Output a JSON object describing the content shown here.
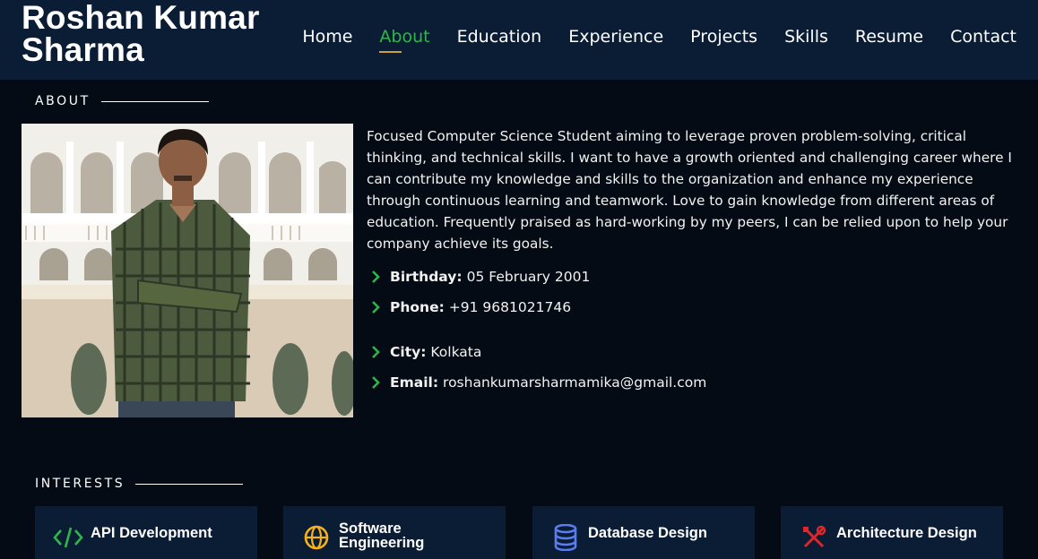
{
  "header": {
    "brand_line1": "Roshan Kumar",
    "brand_line2": "Sharma",
    "nav": [
      {
        "label": "Home"
      },
      {
        "label": "About",
        "active": true
      },
      {
        "label": "Education"
      },
      {
        "label": "Experience"
      },
      {
        "label": "Projects"
      },
      {
        "label": "Skills"
      },
      {
        "label": "Resume"
      },
      {
        "label": "Contact"
      }
    ]
  },
  "about": {
    "section_title": "ABOUT",
    "description": "Focused Computer Science Student aiming to leverage proven problem-solving, critical thinking, and technical skills. I want to have a growth oriented and challenging career where I can contribute my knowledge and skills to the organization and enhance my experience through continuous learning and teamwork. Love to gain knowledge from different areas of education. Frequently praised as hard-working by my peers, I can be relied upon to help your company achieve its goals.",
    "info": [
      {
        "label": "Birthday:",
        "value": "05 February 2001"
      },
      {
        "label": "Phone:",
        "value": "+91 9681021746"
      },
      {
        "label": "City:",
        "value": "Kolkata"
      },
      {
        "label": "Email:",
        "value": "roshankumarsharmamika@gmail.com"
      }
    ]
  },
  "interests": {
    "section_title": "INTERESTS",
    "items": [
      {
        "line1": "API Development",
        "line2": "",
        "icon": "code-icon",
        "color": "#2fb54a"
      },
      {
        "line1": "Software",
        "line2": "Engineering",
        "icon": "globe-icon",
        "color": "#f5b21a"
      },
      {
        "line1": "Database Design",
        "line2": "",
        "icon": "database-icon",
        "color": "#5b7df0"
      },
      {
        "line1": "Architecture Design",
        "line2": "",
        "icon": "tools-icon",
        "color": "#e0262b"
      }
    ]
  },
  "colors": {
    "accent": "#2fb54a",
    "header_bg": "#0b1d35",
    "page_bg": "#040b14"
  }
}
